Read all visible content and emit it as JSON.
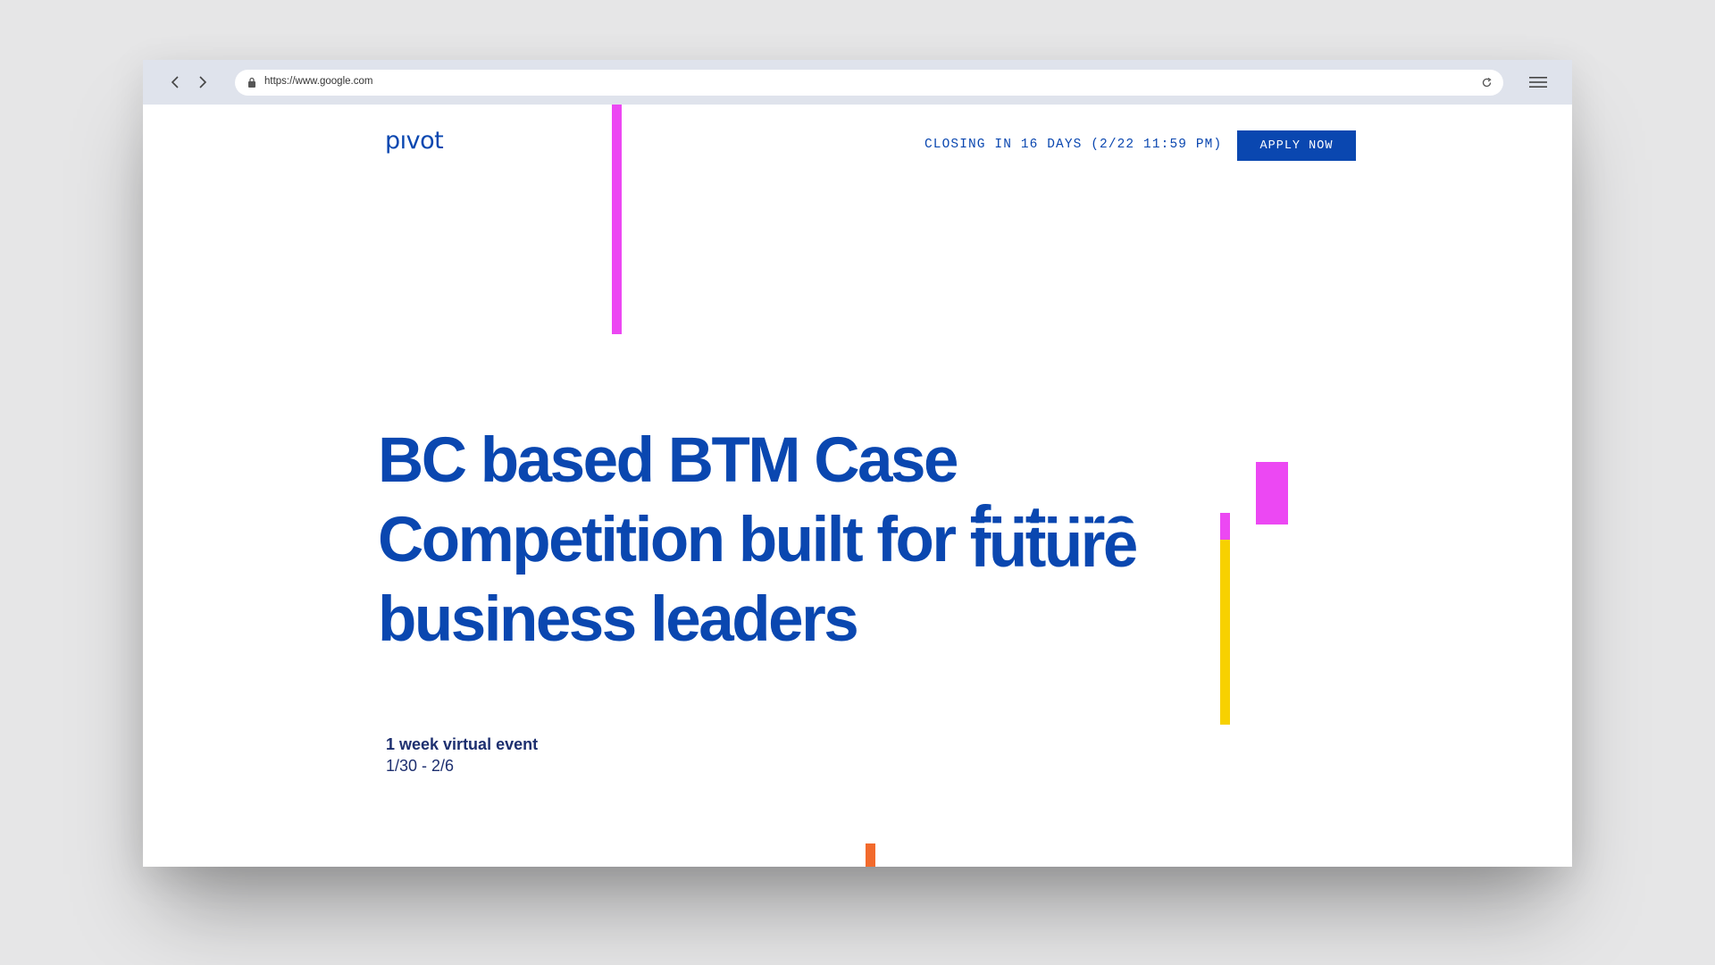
{
  "browser": {
    "url": "https://www.google.com",
    "icons": {
      "back": "chevron-left-icon",
      "forward": "chevron-right-icon",
      "lock": "lock-icon",
      "reload": "reload-icon",
      "menu": "hamburger-menu-icon"
    }
  },
  "header": {
    "logo": "pıvot",
    "closing_text": "CLOSING IN 16 DAYS (2/22 11:59 PM)",
    "apply_label": "APPLY NOW"
  },
  "hero": {
    "line1": "BC based BTM Case",
    "line2_prefix": "Competition built for ",
    "line2_highlight": "future",
    "line3": "business leaders"
  },
  "event": {
    "title": "1 week virtual event",
    "dates": "1/30 - 2/6"
  },
  "colors": {
    "brand_blue": "#0a47b0",
    "magenta": "#ec48f3",
    "yellow": "#f7d100",
    "orange": "#f26a2c",
    "chrome_bg": "#dfe3ec"
  }
}
